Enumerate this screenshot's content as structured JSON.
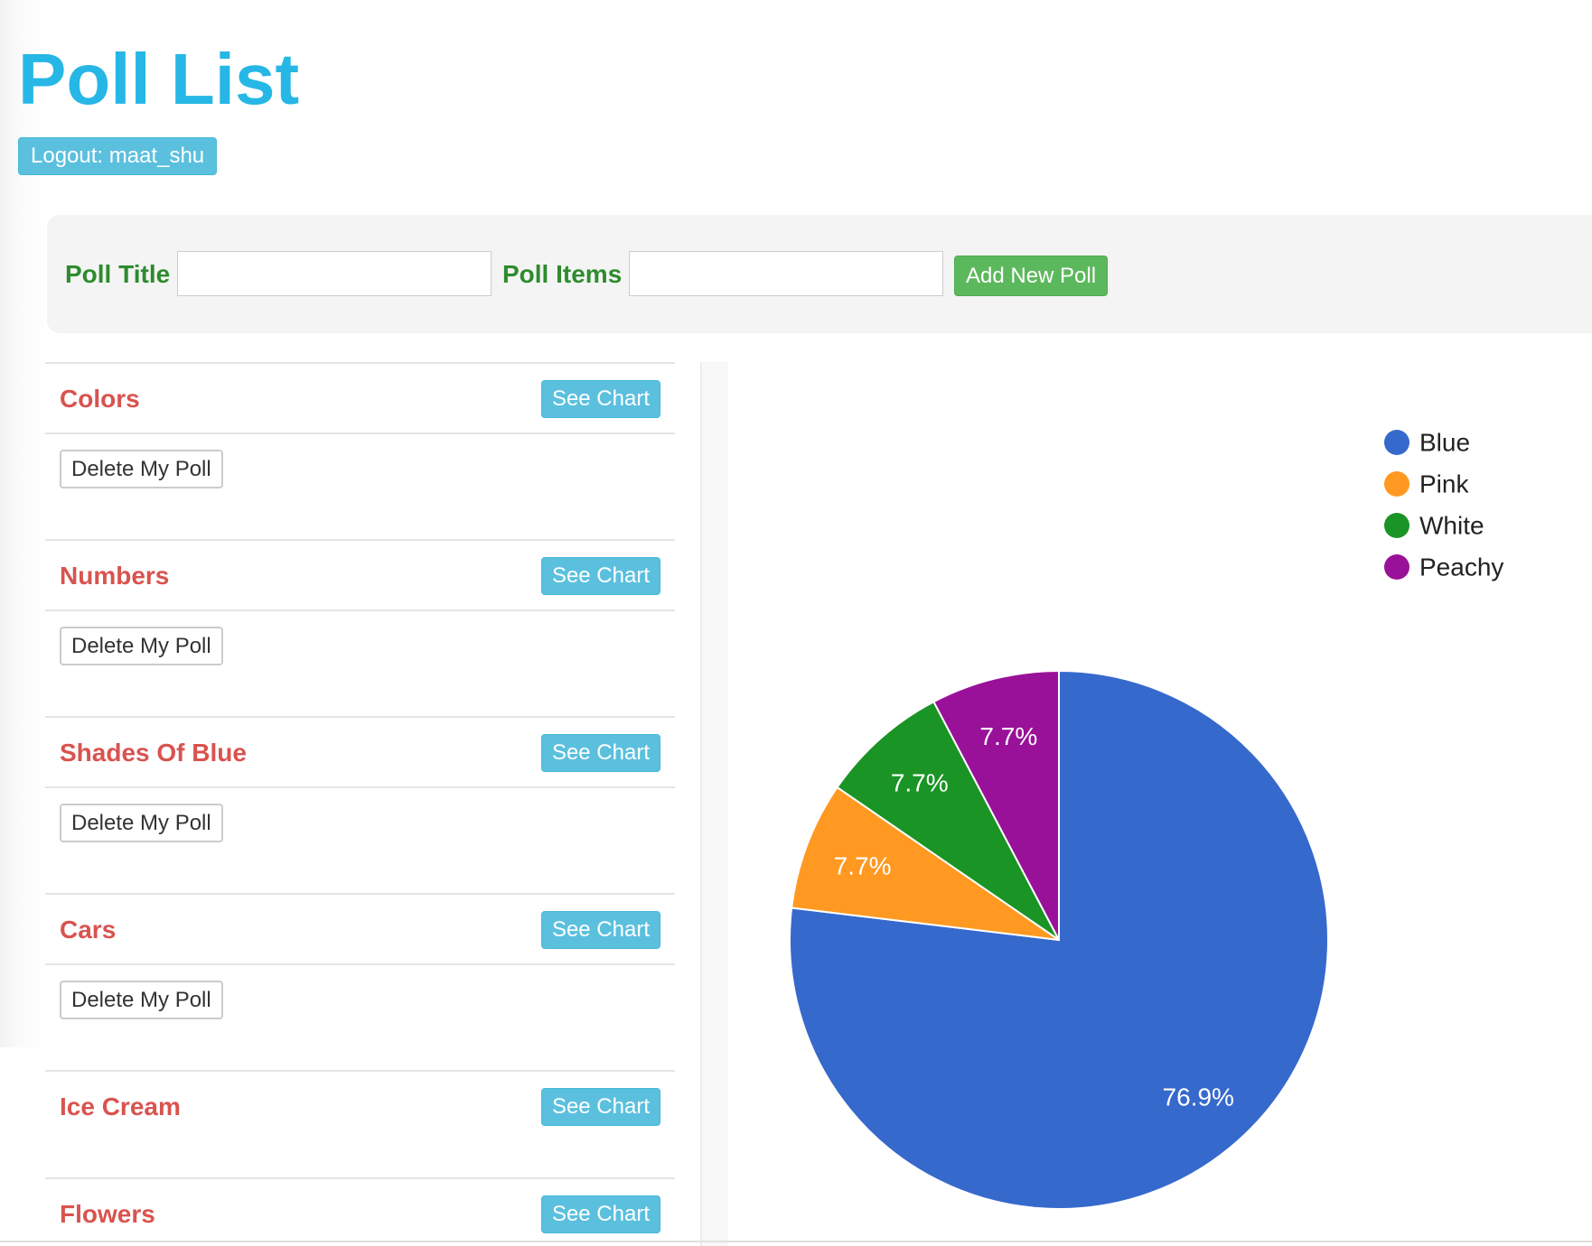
{
  "page": {
    "title": "Poll List",
    "logout_label": "Logout: maat_shu"
  },
  "form": {
    "title_label": "Poll Title",
    "title_value": "",
    "items_label": "Poll Items",
    "items_value": "",
    "add_label": "Add New Poll"
  },
  "polls": [
    {
      "title": "Colors",
      "see_chart": "See Chart",
      "delete": "Delete My Poll"
    },
    {
      "title": "Numbers",
      "see_chart": "See Chart",
      "delete": "Delete My Poll"
    },
    {
      "title": "Shades Of Blue",
      "see_chart": "See Chart",
      "delete": "Delete My Poll"
    },
    {
      "title": "Cars",
      "see_chart": "See Chart",
      "delete": "Delete My Poll"
    },
    {
      "title": "Ice Cream",
      "see_chart": "See Chart"
    },
    {
      "title": "Flowers",
      "see_chart": "See Chart"
    }
  ],
  "colors": {
    "title": "#26b7e6",
    "poll_title": "#d9534f",
    "form_label": "#2e8b2e",
    "info_button": "#5bc0de",
    "success_button": "#5cb85c"
  },
  "chart_data": {
    "type": "pie",
    "legend_position": "top-right",
    "slices": [
      {
        "label": "Blue",
        "value": 76.9,
        "display": "76.9%",
        "color": "#3669cc"
      },
      {
        "label": "Pink",
        "value": 7.7,
        "display": "7.7%",
        "color": "#ff9922"
      },
      {
        "label": "White",
        "value": 7.7,
        "display": "7.7%",
        "color": "#1a9425"
      },
      {
        "label": "Peachy",
        "value": 7.7,
        "display": "7.7%",
        "color": "#991199"
      }
    ]
  }
}
